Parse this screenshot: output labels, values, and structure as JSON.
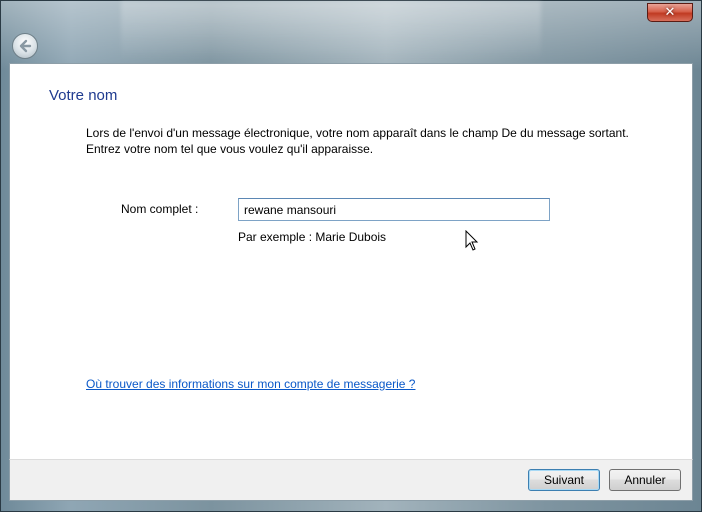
{
  "window": {
    "close_glyph": "✕",
    "back_icon": "back-arrow-icon"
  },
  "page": {
    "title": "Votre nom",
    "description_line1": "Lors de l'envoi d'un message électronique, votre nom apparaît dans le champ De du message sortant.",
    "description_line2": "Entrez votre nom tel que vous voulez qu'il apparaisse."
  },
  "form": {
    "full_name_label": "Nom complet :",
    "full_name_value": "rewane mansouri",
    "example_text": "Par exemple : Marie Dubois"
  },
  "help_link": "Où trouver des informations sur mon compte de messagerie ?",
  "buttons": {
    "next": "Suivant",
    "cancel": "Annuler"
  },
  "colors": {
    "title": "#1e3a8f",
    "link": "#0a58c8",
    "close_button": "#c03a22",
    "default_button_border": "#3c7fb1"
  }
}
